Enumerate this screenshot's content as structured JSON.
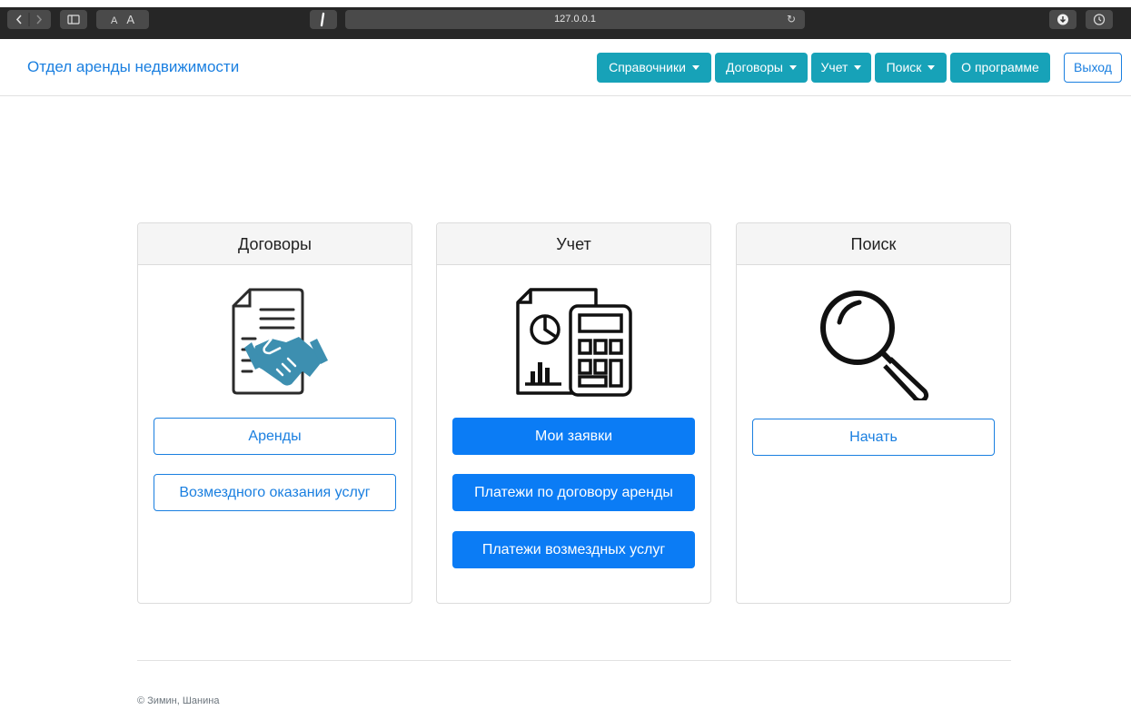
{
  "browser": {
    "url": "127.0.0.1",
    "font_small": "A",
    "font_large": "A"
  },
  "navbar": {
    "brand": "Отдел аренды недвижимости",
    "menus": [
      {
        "label": "Справочники"
      },
      {
        "label": "Договоры"
      },
      {
        "label": "Учет"
      },
      {
        "label": "Поиск"
      },
      {
        "label": "О программе"
      }
    ],
    "logout": "Выход",
    "accent": "#17a2b8"
  },
  "cards": {
    "contracts": {
      "title": "Договоры",
      "icon": "contract-handshake-icon",
      "buttons": [
        "Аренды",
        "Возмездного оказания услуг"
      ]
    },
    "accounting": {
      "title": "Учет",
      "icon": "report-calculator-icon",
      "buttons": [
        "Мои заявки",
        "Платежи по договору аренды",
        "Платежи возмездных услуг"
      ]
    },
    "search": {
      "title": "Поиск",
      "icon": "magnifier-icon",
      "buttons": [
        "Начать"
      ]
    }
  },
  "footer": {
    "text": "© Зимин, Шанина"
  },
  "colors": {
    "primary": "#0b7cf5",
    "link": "#1a7fe0",
    "info": "#17a2b8"
  }
}
